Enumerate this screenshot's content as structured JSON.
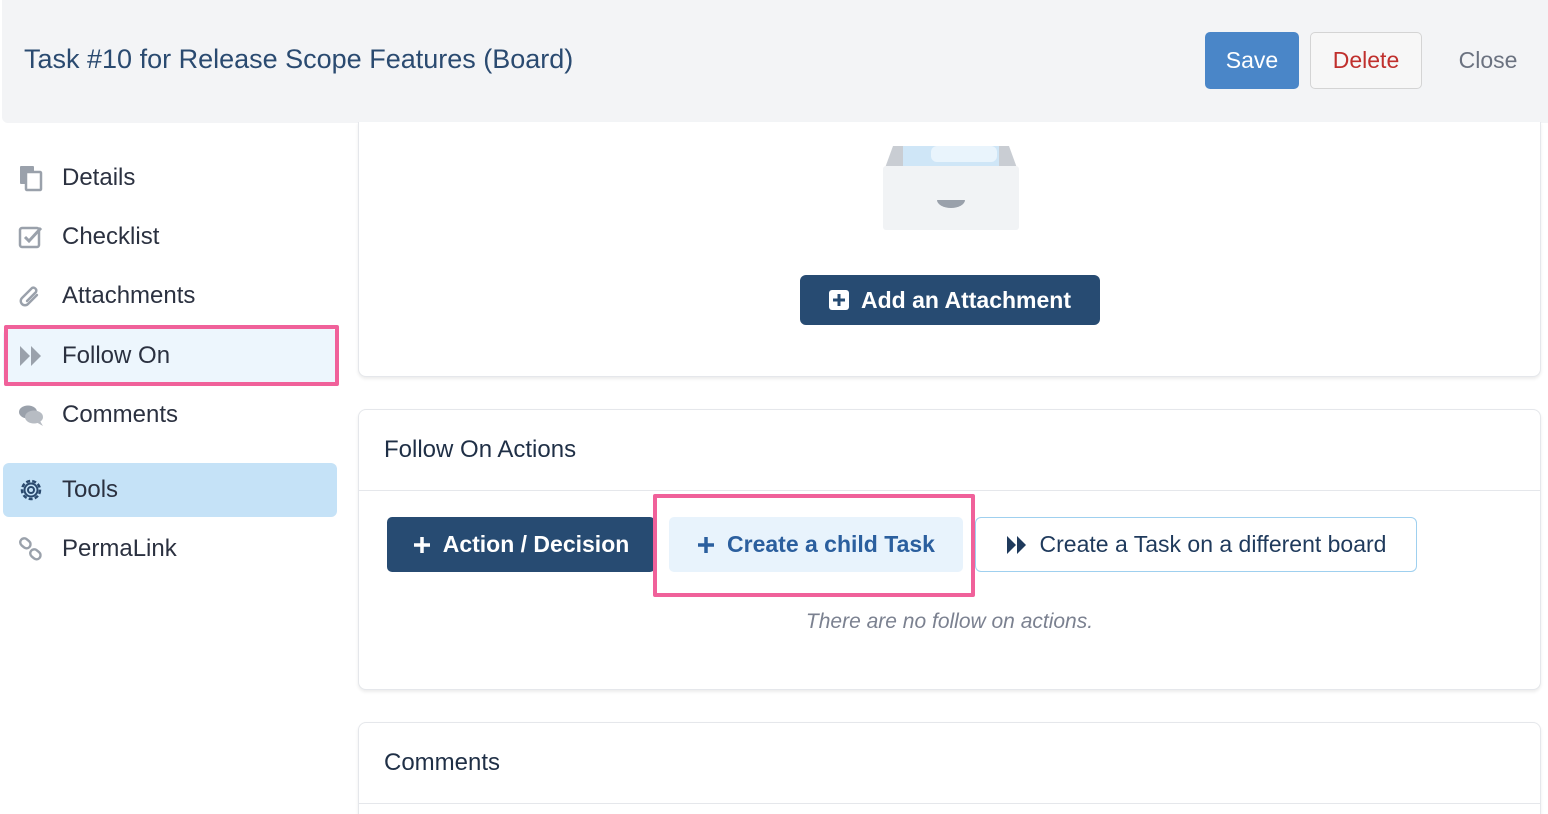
{
  "header": {
    "title": "Task #10 for Release Scope Features (Board)",
    "save_label": "Save",
    "delete_label": "Delete",
    "close_label": "Close"
  },
  "sidebar": {
    "items": [
      {
        "label": "Details",
        "icon": "document-copy-icon"
      },
      {
        "label": "Checklist",
        "icon": "checkbox-icon"
      },
      {
        "label": "Attachments",
        "icon": "paperclip-icon"
      },
      {
        "label": "Follow On",
        "icon": "fast-forward-icon",
        "selected": true
      },
      {
        "label": "Comments",
        "icon": "chat-bubbles-icon"
      },
      {
        "label": "Tools",
        "icon": "gear-icon"
      },
      {
        "label": "PermaLink",
        "icon": "link-icon"
      }
    ]
  },
  "attachments": {
    "add_label": "Add an Attachment"
  },
  "follow_on": {
    "title": "Follow On Actions",
    "action_decision_label": "Action / Decision",
    "create_child_label": "Create a child Task",
    "create_other_board_label": "Create a Task on a different board",
    "empty_message": "There are no follow on actions."
  },
  "comments": {
    "title": "Comments"
  },
  "colors": {
    "primary_dark": "#274b72",
    "save_blue": "#4a86c8",
    "delete_red": "#c0302d",
    "highlight_pink": "#f0619a",
    "tools_bg": "#c5e2f7"
  }
}
